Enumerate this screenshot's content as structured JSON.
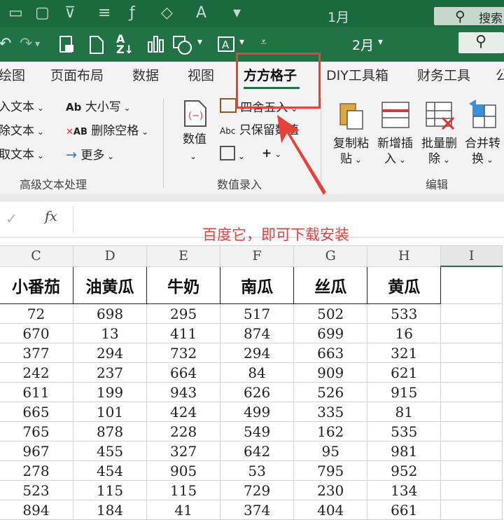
{
  "title_bar": {
    "sheet_name_top": "1月",
    "search_label": "搜索"
  },
  "quick_bar": {
    "sheet_name": "2月",
    "dropdown_glyph": "▾"
  },
  "tabs": [
    "绘图",
    "页面布局",
    "数据",
    "视图",
    "方方格子",
    "DIY工具箱",
    "财务工具",
    "公"
  ],
  "active_tab": "方方格子",
  "ribbon": {
    "text_group": {
      "items_left": [
        "入文本",
        "除文本",
        "取文本"
      ],
      "items_mid": [
        "大小写",
        "删除空格",
        "更多"
      ],
      "icon_abbrev": [
        "Ab",
        "AB"
      ],
      "label": "高级文本处理"
    },
    "value_group": {
      "big_button": "数值",
      "round_label": "四舍五入",
      "keep_value_label": "只保留数值",
      "abc_prefix": "Abc",
      "label": "数值录入"
    },
    "edit_group": {
      "buttons": [
        {
          "line1": "复制粘",
          "line2": "贴"
        },
        {
          "line1": "新增插",
          "line2": "入"
        },
        {
          "line1": "批量删",
          "line2": "除"
        },
        {
          "line1": "合并转",
          "line2": "换"
        }
      ],
      "label": "编辑"
    }
  },
  "formula_bar": {
    "fx_label": "fx",
    "check_glyph": "✓"
  },
  "annotation": "百度它，即可下载安装",
  "sheet": {
    "columns": [
      "C",
      "D",
      "E",
      "F",
      "G",
      "H",
      "I"
    ],
    "headers": [
      "小番茄",
      "油黄瓜",
      "牛奶",
      "南瓜",
      "丝瓜",
      "黄瓜"
    ],
    "rows": [
      [
        "72",
        "698",
        "295",
        "517",
        "502",
        "533"
      ],
      [
        "670",
        "13",
        "411",
        "874",
        "699",
        "16"
      ],
      [
        "377",
        "294",
        "732",
        "294",
        "663",
        "321"
      ],
      [
        "242",
        "237",
        "664",
        "84",
        "909",
        "621"
      ],
      [
        "611",
        "199",
        "943",
        "626",
        "526",
        "915"
      ],
      [
        "665",
        "101",
        "424",
        "499",
        "335",
        "81"
      ],
      [
        "765",
        "878",
        "228",
        "549",
        "162",
        "535"
      ],
      [
        "967",
        "455",
        "327",
        "642",
        "95",
        "981"
      ],
      [
        "278",
        "454",
        "905",
        "53",
        "795",
        "952"
      ],
      [
        "523",
        "115",
        "115",
        "729",
        "230",
        "134"
      ],
      [
        "894",
        "184",
        "41",
        "374",
        "404",
        "661"
      ]
    ]
  },
  "colors": {
    "excel_green": "#217346",
    "annotation_red": "#e8413a"
  }
}
